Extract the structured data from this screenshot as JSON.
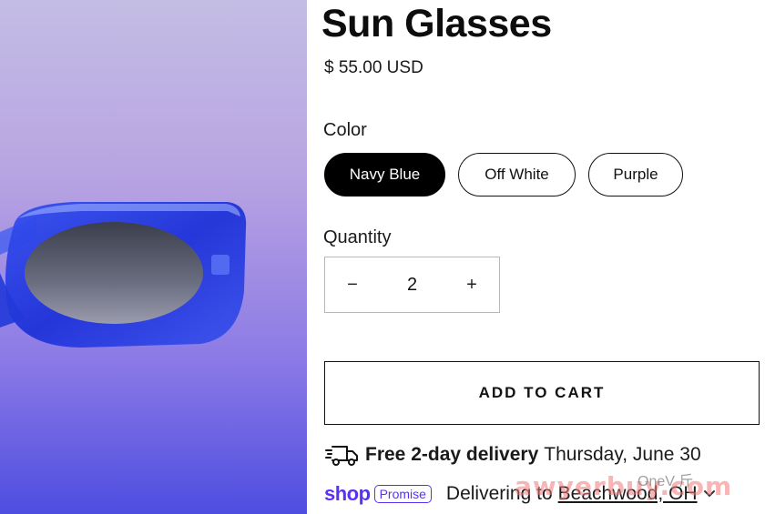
{
  "product": {
    "title": "Sun Glasses",
    "price": "$ 55.00 USD",
    "image_alt": "sunglasses-product-image"
  },
  "color": {
    "label": "Color",
    "options": [
      "Navy Blue",
      "Off White",
      "Purple"
    ],
    "selected": "Navy Blue"
  },
  "quantity": {
    "label": "Quantity",
    "value": "2",
    "minus": "−",
    "plus": "+"
  },
  "cart": {
    "add_label": "ADD TO CART"
  },
  "delivery": {
    "icon": "truck-icon",
    "headline": "Free 2-day delivery",
    "date": "Thursday, June 30"
  },
  "shop_promise": {
    "logo": "shop",
    "badge": "Promise",
    "prefix": "Delivering to",
    "location": "Beachwood, OH"
  },
  "watermark": {
    "text": "awyerbuy.com",
    "secondary": "OneV 斤"
  },
  "colors": {
    "accent": "#5a31f4",
    "selected_swatch": "#000000",
    "panel_gradient_top": "#c3bde4",
    "panel_gradient_bottom": "#4d4de0",
    "frame_blue": "#2a3fe0"
  }
}
